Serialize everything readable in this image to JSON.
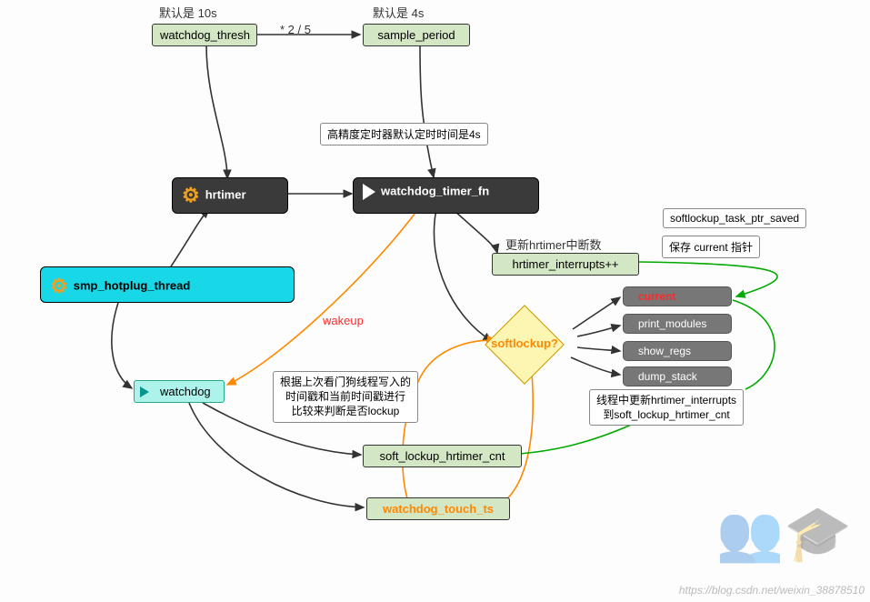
{
  "labels": {
    "default_10s": "默认是 10s",
    "default_4s": "默认是 4s",
    "mult": "* 2 / 5",
    "wakeup": "wakeup",
    "timer_note": "高精度定时器默认定时时间是4s",
    "update_hrtimer": "更新hrtimer中断数",
    "lockup_note_l1": "根据上次看门狗线程写入的",
    "lockup_note_l2": "时间戳和当前时间戳进行",
    "lockup_note_l3": "比较来判断是否lockup",
    "save_ptr": "softlockup_task_ptr_saved",
    "save_cur": "保存 current 指针",
    "thread_update_l1": "线程中更新hrtimer_interrupts",
    "thread_update_l2": "到soft_lockup_hrtimer_cnt"
  },
  "nodes": {
    "watchdog_thresh": "watchdog_thresh",
    "sample_period": "sample_period",
    "hrtimer": "hrtimer",
    "watchdog_timer_fn": "watchdog_timer_fn",
    "smp_hotplug_thread": "smp_hotplug_thread",
    "watchdog": "watchdog",
    "hrtimer_interrupts": "hrtimer_interrupts++",
    "softlockup": "softlockup?",
    "current": "current",
    "print_modules": "print_modules",
    "show_regs": "show_regs",
    "dump_stack": "dump_stack",
    "soft_lockup_hrtimer_cnt": "soft_lockup_hrtimer_cnt",
    "watchdog_touch_ts": "watchdog_touch_ts"
  },
  "watermark": "https://blog.csdn.net/weixin_38878510"
}
